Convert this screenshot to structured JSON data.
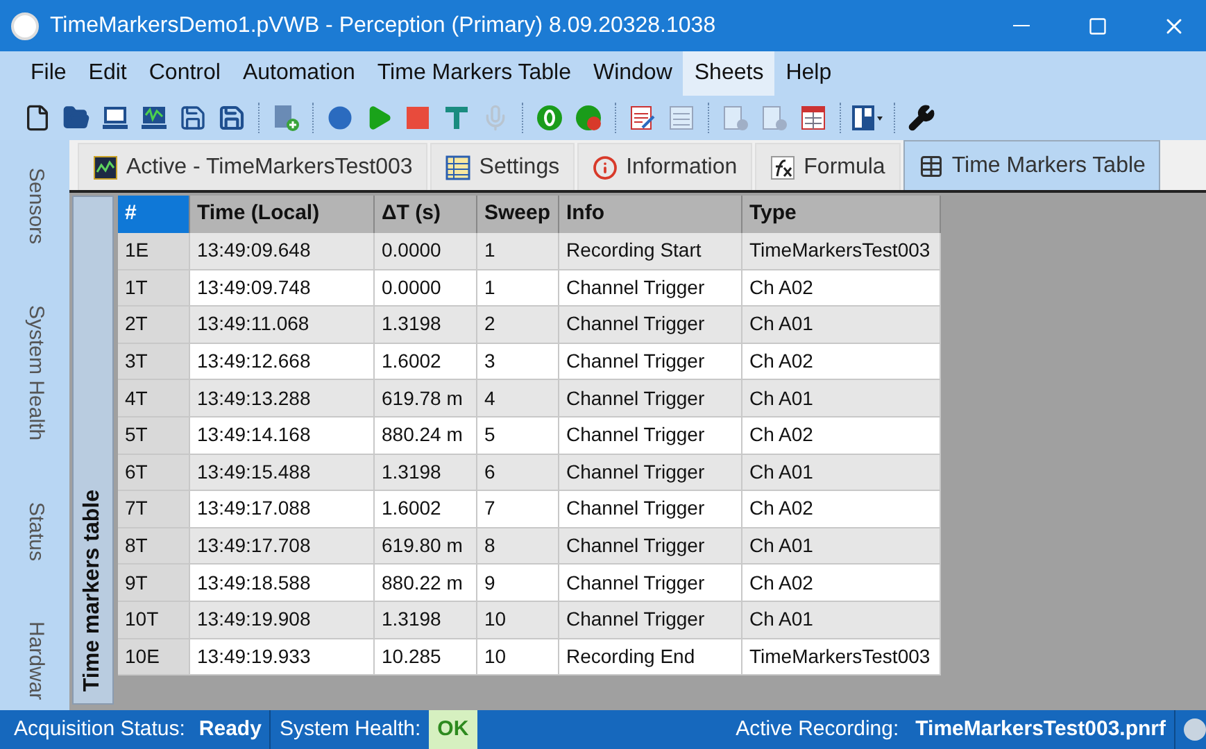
{
  "window": {
    "title": "TimeMarkersDemo1.pVWB - Perception (Primary) 8.09.20328.1038"
  },
  "menu": [
    {
      "label": "File",
      "selected": false
    },
    {
      "label": "Edit",
      "selected": false
    },
    {
      "label": "Control",
      "selected": false
    },
    {
      "label": "Automation",
      "selected": false
    },
    {
      "label": "Time Markers Table",
      "selected": false
    },
    {
      "label": "Window",
      "selected": false
    },
    {
      "label": "Sheets",
      "selected": true
    },
    {
      "label": "Help",
      "selected": false
    }
  ],
  "side_tabs": [
    "Sensors",
    "System Health",
    "Status",
    "Hardwar"
  ],
  "tabs": [
    {
      "label": "Active - TimeMarkersTest003",
      "kind": "recorder",
      "selected": false
    },
    {
      "label": "Settings",
      "kind": "settings",
      "selected": false
    },
    {
      "label": "Information",
      "kind": "info",
      "selected": false
    },
    {
      "label": "Formula",
      "kind": "formula",
      "selected": false
    },
    {
      "label": "Time Markers Table",
      "kind": "table",
      "selected": true
    }
  ],
  "panel_title": "Time markers table",
  "table": {
    "columns": [
      "#",
      "Time (Local)",
      "ΔT (s)",
      "Sweep",
      "Info",
      "Type"
    ],
    "rows": [
      [
        "1E",
        "13:49:09.648",
        "0.0000",
        "1",
        "Recording Start",
        "TimeMarkersTest003"
      ],
      [
        "1T",
        "13:49:09.748",
        "0.0000",
        "1",
        "Channel Trigger",
        "Ch A02"
      ],
      [
        "2T",
        "13:49:11.068",
        "1.3198",
        "2",
        "Channel Trigger",
        "Ch A01"
      ],
      [
        "3T",
        "13:49:12.668",
        "1.6002",
        "3",
        "Channel Trigger",
        "Ch A02"
      ],
      [
        "4T",
        "13:49:13.288",
        "619.78 m",
        "4",
        "Channel Trigger",
        "Ch A01"
      ],
      [
        "5T",
        "13:49:14.168",
        "880.24 m",
        "5",
        "Channel Trigger",
        "Ch A02"
      ],
      [
        "6T",
        "13:49:15.488",
        "1.3198",
        "6",
        "Channel Trigger",
        "Ch A01"
      ],
      [
        "7T",
        "13:49:17.088",
        "1.6002",
        "7",
        "Channel Trigger",
        "Ch A02"
      ],
      [
        "8T",
        "13:49:17.708",
        "619.80 m",
        "8",
        "Channel Trigger",
        "Ch A01"
      ],
      [
        "9T",
        "13:49:18.588",
        "880.22 m",
        "9",
        "Channel Trigger",
        "Ch A02"
      ],
      [
        "10T",
        "13:49:19.908",
        "1.3198",
        "10",
        "Channel Trigger",
        "Ch A01"
      ],
      [
        "10E",
        "13:49:19.933",
        "10.285",
        "10",
        "Recording End",
        "TimeMarkersTest003"
      ]
    ]
  },
  "status_bar": {
    "acquisition_label": "Acquisition Status:",
    "acquisition_value": "Ready",
    "health_label": "System Health:",
    "health_value": "OK",
    "recording_label": "Active Recording:",
    "recording_value": "TimeMarkersTest003.pnrf"
  }
}
